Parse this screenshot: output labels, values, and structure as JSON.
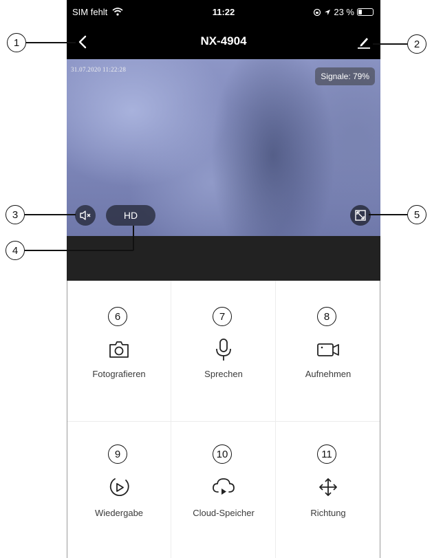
{
  "status_bar": {
    "carrier": "SIM fehlt",
    "time": "11:22",
    "battery": "23 %",
    "battery_level": 0.23
  },
  "nav": {
    "title": "NX-4904",
    "back_icon": "chevron-left-icon",
    "edit_icon": "pencil-icon"
  },
  "video": {
    "timestamp": "31.07.2020 11:22:28",
    "signal": "Signale: 79%",
    "hd_label": "HD"
  },
  "actions": [
    {
      "label": "Fotografieren",
      "icon": "camera-icon",
      "callout": "6"
    },
    {
      "label": "Sprechen",
      "icon": "microphone-icon",
      "callout": "7"
    },
    {
      "label": "Aufnehmen",
      "icon": "video-camera-icon",
      "callout": "8"
    },
    {
      "label": "Wiedergabe",
      "icon": "playback-icon",
      "callout": "9"
    },
    {
      "label": "Cloud-Speicher",
      "icon": "cloud-play-icon",
      "callout": "10"
    },
    {
      "label": "Richtung",
      "icon": "move-arrows-icon",
      "callout": "11"
    }
  ],
  "callouts": [
    "1",
    "2",
    "3",
    "4",
    "5"
  ],
  "colors": {
    "bar_bg": "#000000",
    "band_bg": "#222222",
    "label_text": "#3a3a3a"
  }
}
